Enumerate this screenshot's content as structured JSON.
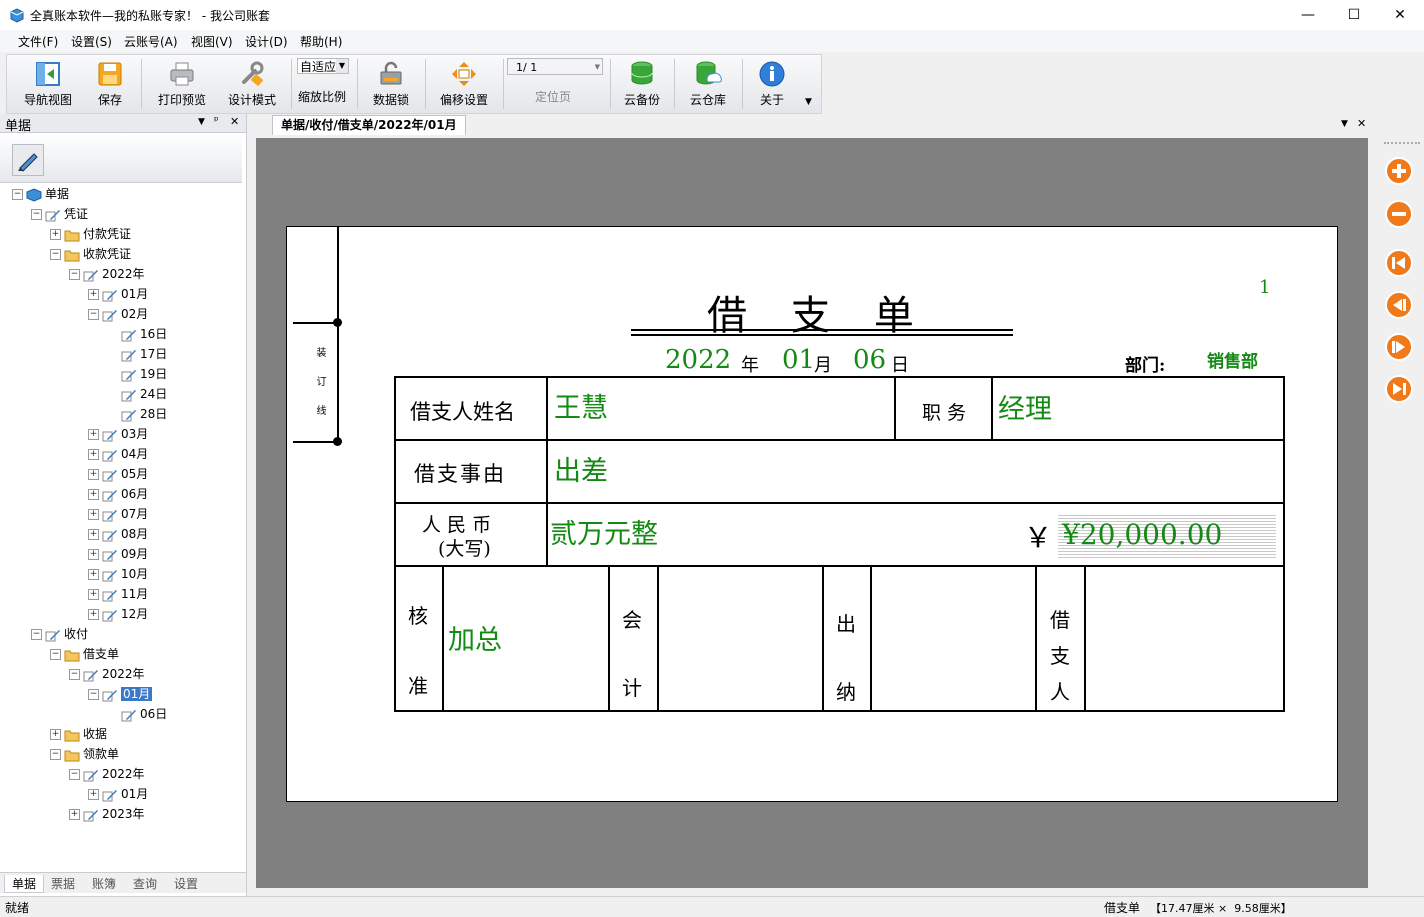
{
  "window": {
    "title": "全真账本软件—我的私账专家！ - 我公司账套",
    "minimize": "—",
    "maximize": "☐",
    "close": "✕"
  },
  "menu": [
    "文件(F)",
    "设置(S)",
    "云账号(A)",
    "视图(V)",
    "设计(D)",
    "帮助(H)"
  ],
  "toolbar": {
    "nav_view": "导航视图",
    "save": "保存",
    "print_preview": "打印预览",
    "design_mode": "设计模式",
    "zoom_value": "自适应",
    "zoom_label": "缩放比例",
    "data_lock": "数据锁",
    "offset": "偏移设置",
    "page_value": "1/ 1",
    "page_label": "定位页",
    "cloud_backup": "云备份",
    "cloud_repo": "云仓库",
    "about": "关于"
  },
  "left_panel": {
    "title": "单据",
    "pin": "ᵖ",
    "close": "✕",
    "tabs": [
      "单据",
      "票据",
      "账簿",
      "查询",
      "设置"
    ]
  },
  "tree": [
    {
      "label": "单据",
      "indent": 0,
      "exp": "−",
      "icon": "book"
    },
    {
      "label": "凭证",
      "indent": 1,
      "exp": "−",
      "icon": "pen"
    },
    {
      "label": "付款凭证",
      "indent": 2,
      "exp": "+",
      "icon": "folder"
    },
    {
      "label": "收款凭证",
      "indent": 2,
      "exp": "−",
      "icon": "folder"
    },
    {
      "label": "2022年",
      "indent": 3,
      "exp": "−",
      "icon": "pen"
    },
    {
      "label": "01月",
      "indent": 4,
      "exp": "+",
      "icon": "pen"
    },
    {
      "label": "02月",
      "indent": 4,
      "exp": "−",
      "icon": "pen"
    },
    {
      "label": "16日",
      "indent": 5,
      "exp": "",
      "icon": "pen"
    },
    {
      "label": "17日",
      "indent": 5,
      "exp": "",
      "icon": "pen"
    },
    {
      "label": "19日",
      "indent": 5,
      "exp": "",
      "icon": "pen"
    },
    {
      "label": "24日",
      "indent": 5,
      "exp": "",
      "icon": "pen"
    },
    {
      "label": "28日",
      "indent": 5,
      "exp": "",
      "icon": "pen"
    },
    {
      "label": "03月",
      "indent": 4,
      "exp": "+",
      "icon": "pen"
    },
    {
      "label": "04月",
      "indent": 4,
      "exp": "+",
      "icon": "pen"
    },
    {
      "label": "05月",
      "indent": 4,
      "exp": "+",
      "icon": "pen"
    },
    {
      "label": "06月",
      "indent": 4,
      "exp": "+",
      "icon": "pen"
    },
    {
      "label": "07月",
      "indent": 4,
      "exp": "+",
      "icon": "pen"
    },
    {
      "label": "08月",
      "indent": 4,
      "exp": "+",
      "icon": "pen"
    },
    {
      "label": "09月",
      "indent": 4,
      "exp": "+",
      "icon": "pen"
    },
    {
      "label": "10月",
      "indent": 4,
      "exp": "+",
      "icon": "pen"
    },
    {
      "label": "11月",
      "indent": 4,
      "exp": "+",
      "icon": "pen"
    },
    {
      "label": "12月",
      "indent": 4,
      "exp": "+",
      "icon": "pen"
    },
    {
      "label": "收付",
      "indent": 1,
      "exp": "−",
      "icon": "pen"
    },
    {
      "label": "借支单",
      "indent": 2,
      "exp": "−",
      "icon": "folder"
    },
    {
      "label": "2022年",
      "indent": 3,
      "exp": "−",
      "icon": "pen"
    },
    {
      "label": "01月",
      "indent": 4,
      "exp": "−",
      "icon": "pen",
      "selected": true
    },
    {
      "label": "06日",
      "indent": 5,
      "exp": "",
      "icon": "pen"
    },
    {
      "label": "收据",
      "indent": 2,
      "exp": "+",
      "icon": "folder"
    },
    {
      "label": "领款单",
      "indent": 2,
      "exp": "−",
      "icon": "folder"
    },
    {
      "label": "2022年",
      "indent": 3,
      "exp": "−",
      "icon": "pen"
    },
    {
      "label": "01月",
      "indent": 4,
      "exp": "+",
      "icon": "pen"
    },
    {
      "label": "2023年",
      "indent": 3,
      "exp": "+",
      "icon": "pen"
    }
  ],
  "doc_tab": {
    "title": "单据/收付/借支单/2022年/01月"
  },
  "form": {
    "page_no": "1",
    "title": "借  支  单",
    "binding_label": "装 订 线",
    "year": "2022",
    "year_unit": "年",
    "month": "01",
    "month_unit": "月",
    "day": "06",
    "day_unit": "日",
    "dept_label": "部门:",
    "dept_value": "销售部",
    "borrower_label": "借支人姓名",
    "borrower_value": "王慧",
    "position_label": "职 务",
    "position_value": "经理",
    "reason_label": "借支事由",
    "reason_value": "出差",
    "rmb_label_1": "人 民 币",
    "rmb_label_2": "(大写)",
    "amount_words": "贰万元整",
    "yen_sign": "￥",
    "amount_value": "¥20,000.00",
    "approve_1": "核",
    "approve_2": "准",
    "approve_value": "加总",
    "accountant_1": "会",
    "accountant_2": "计",
    "cashier_1": "出",
    "cashier_2": "纳",
    "borrower_sig_1": "借",
    "borrower_sig_2": "支",
    "borrower_sig_3": "人"
  },
  "status": {
    "left": "就绪",
    "doc_name": "借支单",
    "size": "【17.47厘米 ×  9.58厘米】"
  },
  "colors": {
    "form_green": "#148a14",
    "selection": "#3a78c8"
  }
}
